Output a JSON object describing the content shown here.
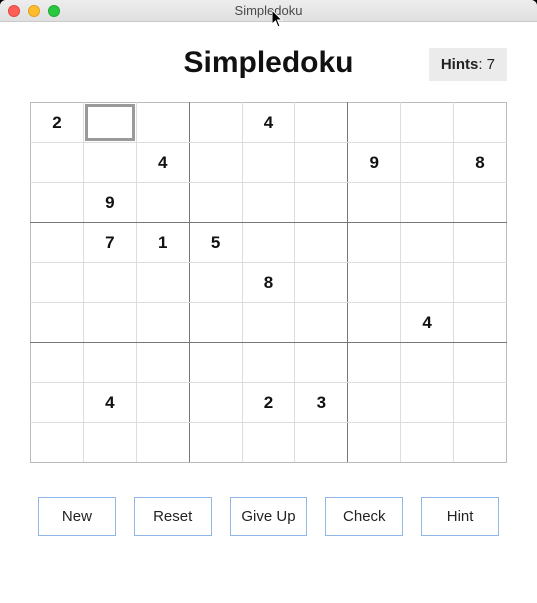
{
  "window": {
    "title": "Simpledoku"
  },
  "header": {
    "title": "Simpledoku"
  },
  "hints": {
    "label": "Hints",
    "count": "7"
  },
  "board": {
    "selected": {
      "row": 0,
      "col": 1
    },
    "grid": [
      [
        "2",
        "",
        "",
        "",
        "4",
        "",
        "",
        "",
        ""
      ],
      [
        "",
        "",
        "4",
        "",
        "",
        "",
        "9",
        "",
        "8"
      ],
      [
        "",
        "9",
        "",
        "",
        "",
        "",
        "",
        "",
        ""
      ],
      [
        "",
        "7",
        "1",
        "5",
        "",
        "",
        "",
        "",
        ""
      ],
      [
        "",
        "",
        "",
        "",
        "8",
        "",
        "",
        "",
        ""
      ],
      [
        "",
        "",
        "",
        "",
        "",
        "",
        "",
        "4",
        ""
      ],
      [
        "",
        "",
        "",
        "",
        "",
        "",
        "",
        "",
        ""
      ],
      [
        "",
        "4",
        "",
        "",
        "2",
        "3",
        "",
        "",
        ""
      ],
      [
        "",
        "",
        "",
        "",
        "",
        "",
        "",
        "",
        ""
      ]
    ]
  },
  "buttons": {
    "new": "New",
    "reset": "Reset",
    "giveup": "Give Up",
    "check": "Check",
    "hint": "Hint"
  }
}
